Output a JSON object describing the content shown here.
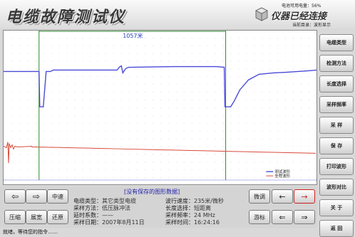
{
  "header": {
    "title": "电缆故障测试仪",
    "battery_label": "电池可用电量：",
    "battery_value": "56%",
    "status": "仪器已经连接",
    "mode_label": "当前目录：",
    "mode_value": "波形显示"
  },
  "sidebar": {
    "items": [
      {
        "label": "电缆类型"
      },
      {
        "label": "检测方法"
      },
      {
        "label": "长度选择"
      },
      {
        "label": "采样频率"
      },
      {
        "label": "采 样"
      },
      {
        "label": "保 存"
      },
      {
        "label": "打印波形"
      },
      {
        "label": "波形对比"
      },
      {
        "label": "关 于"
      },
      {
        "label": "返 回"
      }
    ]
  },
  "chart_data": {
    "type": "line",
    "marker_label": "1057米",
    "series": [
      {
        "name": "测试波形",
        "color": "#4a4ad8"
      },
      {
        "name": "全程波形",
        "color": "#d94a3a"
      }
    ],
    "grid": true
  },
  "panel": {
    "notice": "[没有保存的图形数据]",
    "buttons": {
      "left": "⇦",
      "right": "⇨",
      "mid_speed": "中速",
      "compress": "压缩",
      "expand": "展宽",
      "restore": "还原",
      "fine_tune": "微调",
      "cursor": "游标",
      "arrow_left": "←",
      "arrow_right": "→",
      "arrow_left2": "⇐",
      "arrow_right2": "⇒"
    },
    "info": {
      "cable_type_label": "电缆类型：",
      "cable_type": "其它类型电缆",
      "wave_speed_label": "波行速度：",
      "wave_speed": "235米/微秒",
      "method_label": "采样方法：",
      "method": "低压脉冲法",
      "length_label": "长度选择：",
      "length": "短距离",
      "delay_label": "延时系数：",
      "delay": "——",
      "freq_label": "采样频率：",
      "freq": "24 MHz",
      "date_label": "采样日期：",
      "date": "2007年8月11日",
      "time_label": "采样时间：",
      "time": "16:24:16"
    }
  },
  "footer": {
    "text": "就绪，等待您的指令……"
  }
}
